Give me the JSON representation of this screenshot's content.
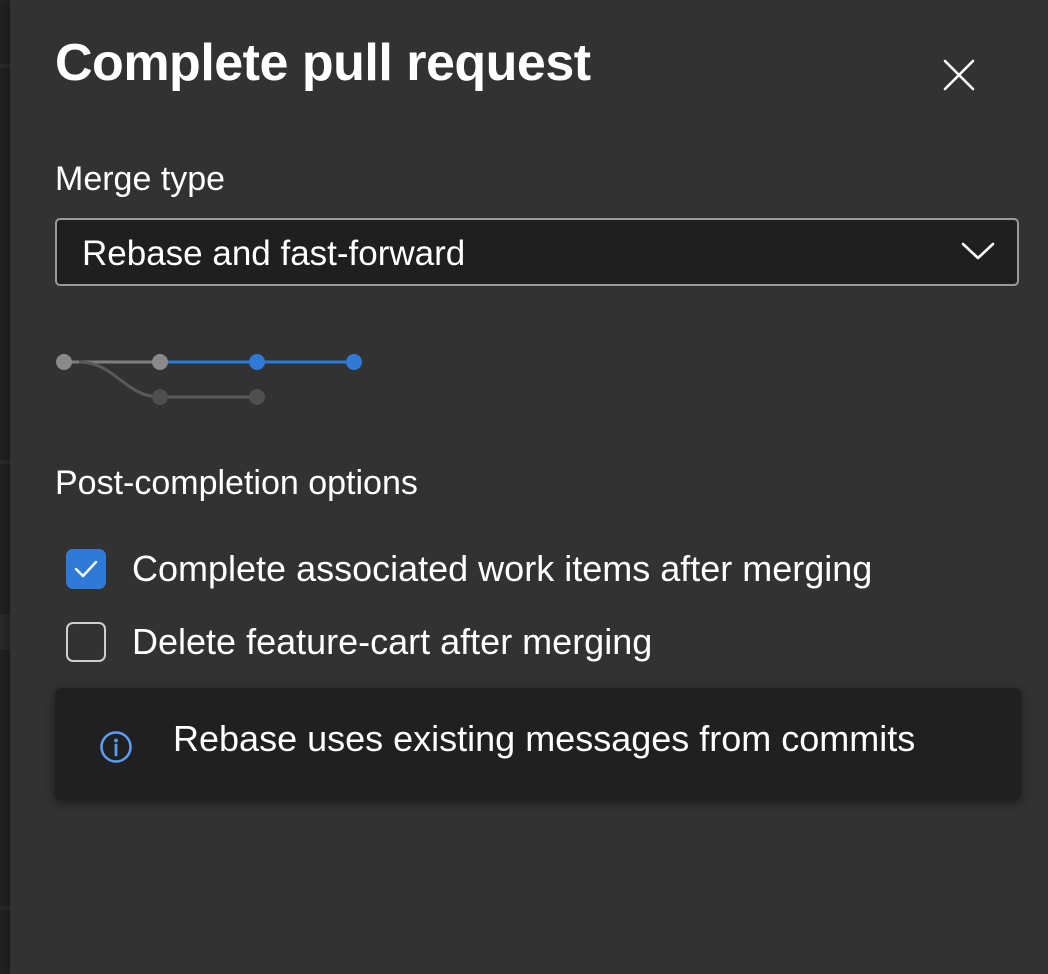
{
  "dialog": {
    "title": "Complete pull request",
    "close_icon": "close-icon"
  },
  "merge": {
    "label": "Merge type",
    "selected": "Rebase and fast-forward",
    "dropdown_icon": "chevron-down-icon"
  },
  "post_completion": {
    "label": "Post-completion options",
    "options": [
      {
        "label": "Complete associated work items after merging",
        "checked": true
      },
      {
        "label": "Delete feature-cart after merging",
        "checked": false
      }
    ]
  },
  "info": {
    "icon": "info-icon",
    "message": "Rebase uses existing messages from commits"
  },
  "colors": {
    "accent": "#2f7ad6",
    "panel_bg": "#323232",
    "input_bg": "#1f1f1f",
    "info_bg": "#202020",
    "info_icon": "#5b9cf0",
    "text": "#ffffff"
  }
}
